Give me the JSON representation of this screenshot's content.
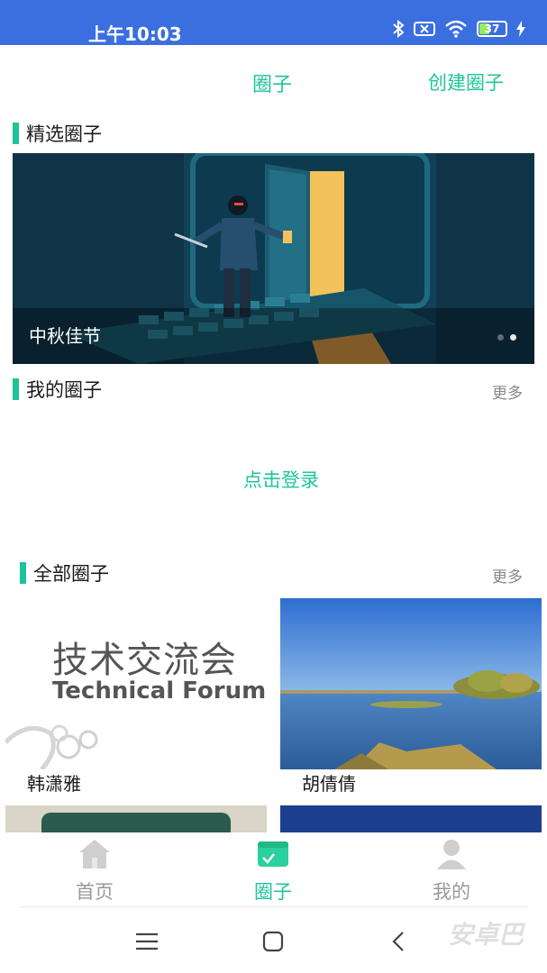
{
  "status_bar": {
    "time": "上午10:03",
    "battery": "37"
  },
  "header": {
    "title": "圈子",
    "create": "创建圈子"
  },
  "featured": {
    "title": "精选圈子",
    "banner_caption": "中秋佳节"
  },
  "my_circles": {
    "title": "我的圈子",
    "more": "更多",
    "login": "点击登录"
  },
  "all_circles": {
    "title": "全部圈子",
    "more": "更多",
    "cards": [
      {
        "name": "韩潇雅",
        "image_cn": "技术交流会",
        "image_en": "Technical Forum"
      },
      {
        "name": "胡倩倩"
      }
    ]
  },
  "bottom_nav": {
    "items": [
      {
        "label": "首页",
        "icon": "home-icon"
      },
      {
        "label": "圈子",
        "icon": "circle-icon"
      },
      {
        "label": "我的",
        "icon": "user-icon"
      }
    ]
  },
  "watermark": "安卓巴",
  "colors": {
    "accent": "#1fc49a",
    "status_bar": "#3b6fe0"
  }
}
